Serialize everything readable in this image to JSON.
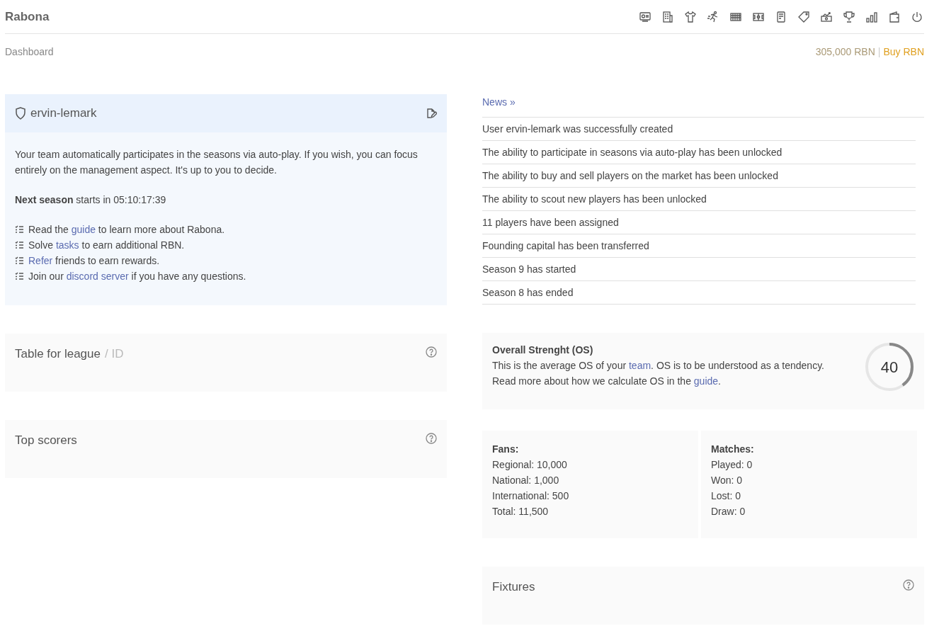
{
  "brand": "Rabona",
  "breadcrumb": "Dashboard",
  "balance": {
    "amount": "305,000 RBN",
    "separator": "|",
    "buy": "Buy RBN"
  },
  "team_card": {
    "name": "ervin-lemark",
    "intro": "Your team automatically participates in the seasons via auto-play. If you wish, you can focus entirely on the management aspect. It's up to you to decide.",
    "next_season": "**Next season** starts in 05:10:17:39",
    "tips": [
      [
        {
          "kind": "text",
          "text": "Read the "
        },
        {
          "kind": "link",
          "text": "guide"
        },
        {
          "kind": "text",
          "text": " to learn more about Rabona."
        }
      ],
      [
        {
          "kind": "text",
          "text": "Solve "
        },
        {
          "kind": "link",
          "text": "tasks"
        },
        {
          "kind": "text",
          "text": " to earn additional RBN."
        }
      ],
      [
        {
          "kind": "link",
          "text": "Refer"
        },
        {
          "kind": "text",
          "text": " friends to earn rewards."
        }
      ],
      [
        {
          "kind": "text",
          "text": "Join our "
        },
        {
          "kind": "link",
          "text": "discord server"
        },
        {
          "kind": "text",
          "text": " if you have any questions."
        }
      ]
    ]
  },
  "league_table": {
    "title": "Table for league",
    "suffix": "/ ID"
  },
  "top_scorers": {
    "title": "Top scorers"
  },
  "news": {
    "title": "News »",
    "items": [
      "User ervin-lemark was successfully created",
      "The ability to participate in seasons via auto-play has been unlocked",
      "The ability to buy and sell players on the market has been unlocked",
      "The ability to scout new players has been unlocked",
      "11 players have been assigned",
      "Founding capital has been transferred",
      "Season 9 has started",
      "Season 8 has ended"
    ]
  },
  "overall_strength": {
    "title": "Overall Strenght (OS)",
    "lines": [
      [
        {
          "kind": "text",
          "text": "This is the average OS of your "
        },
        {
          "kind": "link",
          "text": "team"
        },
        {
          "kind": "text",
          "text": ". OS is to be understood as a tendency."
        }
      ],
      [
        {
          "kind": "text",
          "text": "Read more about how we calculate OS in the "
        },
        {
          "kind": "link",
          "text": "guide"
        },
        {
          "kind": "text",
          "text": "."
        }
      ]
    ],
    "value": "40",
    "level": 0.4
  },
  "stats": [
    {
      "title": "Fans:",
      "rows": [
        "Regional: 10,000",
        "National: 1,000",
        "International: 500",
        "Total: 11,500"
      ]
    },
    {
      "title": "Matches:",
      "rows": [
        "Played: 0",
        "Won: 0",
        "Lost: 0",
        "Draw: 0"
      ]
    }
  ],
  "fixtures": {
    "title": "Fixtures"
  }
}
